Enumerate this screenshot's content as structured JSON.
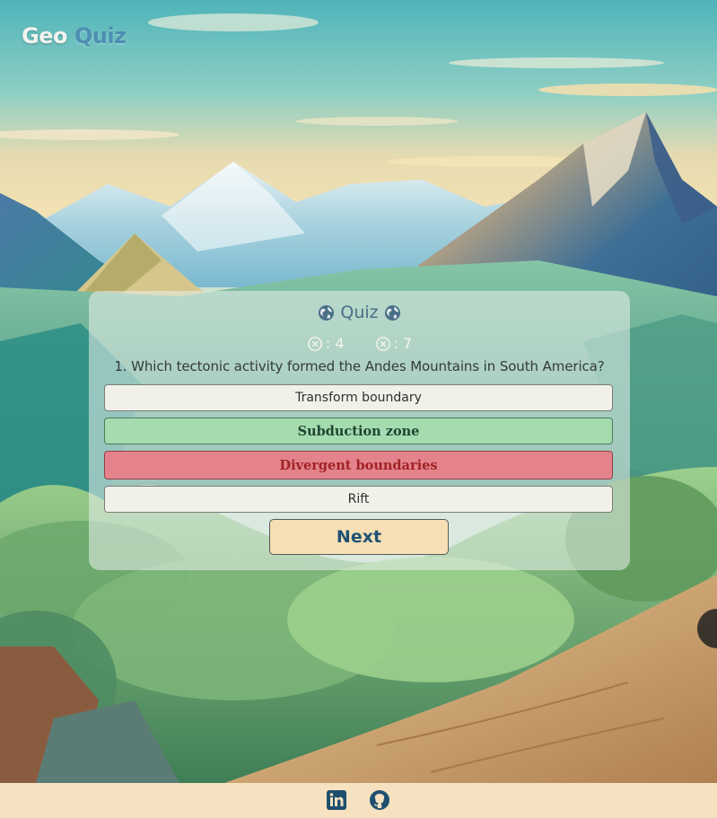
{
  "brand": {
    "geo": "Geo",
    "quiz": "Quiz"
  },
  "quiz": {
    "title": "Quiz",
    "scores": [
      {
        "value": ": 4",
        "icon": "circle-x-icon"
      },
      {
        "value": ": 7",
        "icon": "circle-x-icon"
      }
    ],
    "question": "1. Which tectonic activity formed the Andes Mountains in South America?",
    "answers": [
      {
        "label": "Transform boundary",
        "state": "neutral"
      },
      {
        "label": "Subduction zone",
        "state": "correct"
      },
      {
        "label": "Divergent boundaries",
        "state": "wrong"
      },
      {
        "label": "Rift",
        "state": "neutral"
      }
    ],
    "next_label": "Next"
  },
  "footer": {
    "links": [
      {
        "icon": "linkedin-icon"
      },
      {
        "icon": "github-icon"
      }
    ]
  },
  "colors": {
    "footer_bg": "#f6e2c0",
    "correct_bg": "#a4dcb0",
    "wrong_bg": "#e4838b",
    "next_bg": "#f7dfb5",
    "accent": "#1f5173"
  }
}
